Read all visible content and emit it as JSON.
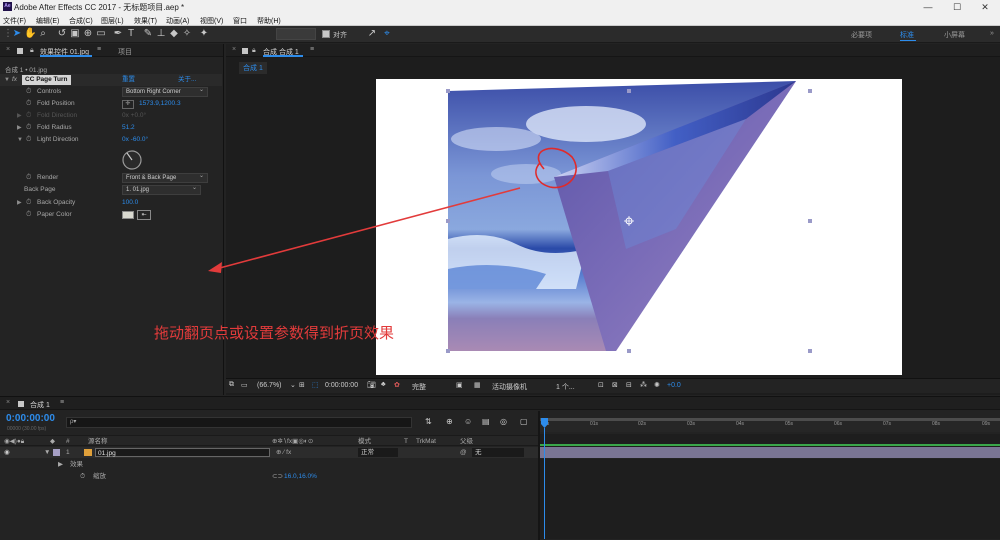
{
  "app": {
    "logo_text": "Ae",
    "title": "Adobe After Effects CC 2017 - 无标题项目.aep *",
    "min": "—",
    "max": "☐",
    "close": "✕"
  },
  "menu": [
    "文件(F)",
    "编辑(E)",
    "合成(C)",
    "图层(L)",
    "效果(T)",
    "动画(A)",
    "视图(V)",
    "窗口",
    "帮助(H)"
  ],
  "toolbar": {
    "snap_label": "对齐",
    "workspaces": [
      "必要项",
      "标准",
      "小屏幕"
    ],
    "workspace_active": 1,
    "more": "»"
  },
  "effects_panel": {
    "tab_label": "效果控件 01.jpg",
    "menu_icon": "≡",
    "project_tab": "项目",
    "breadcrumb": "合成 1 • 01.jpg",
    "effect_name": "CC Page Turn",
    "reset": "重置",
    "about": "关于...",
    "props": [
      {
        "label": "Controls",
        "value": "Bottom Right Corner",
        "kind": "dropdown"
      },
      {
        "label": "Fold Position",
        "value": "1573.9,1200.3",
        "kind": "point"
      },
      {
        "label": "Fold Direction",
        "value": "0x +0.0°",
        "kind": "disabled"
      },
      {
        "label": "Fold Radius",
        "value": "51.2",
        "kind": "value"
      },
      {
        "label": "Light Direction",
        "value": "0x -60.0°",
        "kind": "value"
      },
      {
        "label": "Render",
        "value": "Front & Back Page",
        "kind": "dropdown"
      },
      {
        "label": "Back Page",
        "value": "1. 01.jpg",
        "kind": "dropdown"
      },
      {
        "label": "Back Opacity",
        "value": "100.0",
        "kind": "value"
      },
      {
        "label": "Paper Color",
        "value": "",
        "kind": "color"
      }
    ]
  },
  "comp_panel": {
    "tab_label": "合成 合成 1",
    "menu_icon": "≡",
    "sub_tab": "合成 1"
  },
  "annotation": {
    "text": "拖动翻页点或设置参数得到折页效果",
    "color": "#e23b3b"
  },
  "viewer_bar": {
    "zoom": "(66.7%)",
    "timecode": "0:00:00:00",
    "resolution": "完整",
    "camera": "活动摄像机",
    "views": "1 个...",
    "exposure": "+0.0"
  },
  "timeline": {
    "tab_label": "合成 1",
    "menu_icon": "≡",
    "timecode": "0:00:00:00",
    "fps": "00000 (30.00 fps)",
    "search_placeholder": "ρ▾",
    "col_source": "源名称",
    "col_mode": "模式",
    "col_t": "T",
    "col_trkmat": "TrkMat",
    "col_parent": "父级",
    "layer_num": "1",
    "layer_name": "01.jpg",
    "layer_mode": "正常",
    "layer_parent": "无",
    "effects_label": "效果",
    "scale_label": "缩放",
    "scale_value": "16.0,16.0%",
    "ruler": [
      "0s",
      "01s",
      "02s",
      "03s",
      "04s",
      "05s",
      "06s",
      "07s",
      "08s",
      "09s"
    ]
  }
}
